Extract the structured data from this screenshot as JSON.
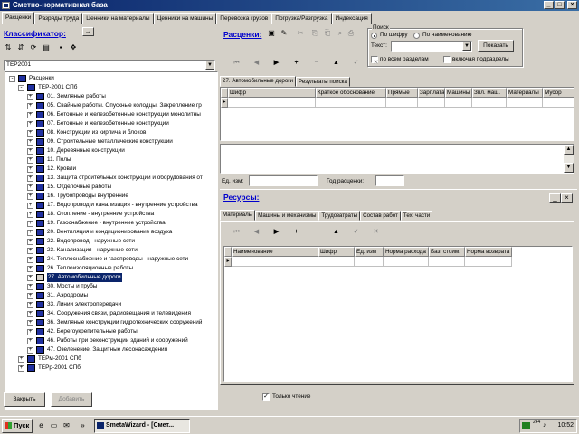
{
  "window": {
    "title": "Сметно-нормативная база"
  },
  "main_tabs": [
    "Расценки",
    "Разряды труда",
    "Ценники на материалы",
    "Ценники на машины",
    "Перевозка грузов",
    "Погрузка/Разгрузка",
    "Индексация"
  ],
  "classifier": {
    "title": "Классификатор:",
    "combo_value": "ТЕР2001",
    "tree": [
      {
        "label": "Расценки",
        "level": 0,
        "sign": "-"
      },
      {
        "label": "ТЕР-2001 СПб",
        "level": 1,
        "sign": "-"
      },
      {
        "label": "01. Земляные работы",
        "level": 2,
        "sign": "+"
      },
      {
        "label": "05. Свайные работы. Опускные колодцы. Закрепление гр",
        "level": 2,
        "sign": "+"
      },
      {
        "label": "06. Бетонные и железобетонные конструкции монолитны",
        "level": 2,
        "sign": "+"
      },
      {
        "label": "07. Бетонные и железобетонные конструкции",
        "level": 2,
        "sign": "+"
      },
      {
        "label": "08. Конструкции из кирпича и блоков",
        "level": 2,
        "sign": "+"
      },
      {
        "label": "09. Строительные металлические конструкции",
        "level": 2,
        "sign": "+"
      },
      {
        "label": "10. Деревянные конструкции",
        "level": 2,
        "sign": "+"
      },
      {
        "label": "11. Полы",
        "level": 2,
        "sign": "+"
      },
      {
        "label": "12. Кровли",
        "level": 2,
        "sign": "+"
      },
      {
        "label": "13. Защита строительных конструкций и оборудования от",
        "level": 2,
        "sign": "+"
      },
      {
        "label": "15. Отделочные работы",
        "level": 2,
        "sign": "+"
      },
      {
        "label": "16. Трубопроводы внутренние",
        "level": 2,
        "sign": "+"
      },
      {
        "label": "17. Водопровод и канализация - внутренние устройства",
        "level": 2,
        "sign": "+"
      },
      {
        "label": "18. Отопление - внутренние устройства",
        "level": 2,
        "sign": "+"
      },
      {
        "label": "19. Газоснабжение - внутренние устройства",
        "level": 2,
        "sign": "+"
      },
      {
        "label": "20. Вентиляция и кондиционирование воздуха",
        "level": 2,
        "sign": "+"
      },
      {
        "label": "22. Водопровод - наружные сети",
        "level": 2,
        "sign": "+"
      },
      {
        "label": "23. Канализация - наружные сети",
        "level": 2,
        "sign": "+"
      },
      {
        "label": "24. Теплоснабжение и газопроводы - наружные сети",
        "level": 2,
        "sign": "+"
      },
      {
        "label": "26. Теплоизоляционные работы",
        "level": 2,
        "sign": "+"
      },
      {
        "label": "27. Автомобильные дороги",
        "level": 2,
        "sign": "+",
        "selected": true
      },
      {
        "label": "30. Мосты и трубы",
        "level": 2,
        "sign": "+"
      },
      {
        "label": "31. Аэродромы",
        "level": 2,
        "sign": "+"
      },
      {
        "label": "33. Линии электропередачи",
        "level": 2,
        "sign": "+"
      },
      {
        "label": "34. Сооружения связи, радиовещания и телевидения",
        "level": 2,
        "sign": "+"
      },
      {
        "label": "36. Земляные конструкции гидротехнических сооружений",
        "level": 2,
        "sign": "+"
      },
      {
        "label": "42. Берегоукрепительные работы",
        "level": 2,
        "sign": "+"
      },
      {
        "label": "46. Работы при реконструкции зданий и сооружений",
        "level": 2,
        "sign": "+"
      },
      {
        "label": "47. Озеленение. Защитные лесонасаждения",
        "level": 2,
        "sign": "+"
      },
      {
        "label": "ТЕРм-2001 СПб",
        "level": 1,
        "sign": "+"
      },
      {
        "label": "ТЕРр-2001 СПб",
        "level": 1,
        "sign": "+"
      }
    ]
  },
  "rates": {
    "title": "Расценки:",
    "search": {
      "group_title": "Поиск",
      "by_code": "По шифру",
      "by_name": "По наименованию",
      "text_label": "Текст:",
      "show_button": "Показать",
      "all_sections": "по всем разделам",
      "include_subsections": "включая подразделы"
    },
    "tabs": [
      "27. Автомобильные дороги",
      "Результаты поиска"
    ],
    "columns": [
      "Шифр",
      "Краткое обоснование",
      "Прямые",
      "Зарплата",
      "Машины",
      "Зпл. маш.",
      "Материалы",
      "Мусор"
    ],
    "unit_label": "Ед. изм:",
    "year_label": "Год расценки:"
  },
  "resources": {
    "title": "Ресурсы:",
    "tabs": [
      "Материалы",
      "Машины и механизмы",
      "Трудозатраты",
      "Состав работ",
      "Тех. части"
    ],
    "columns": [
      "Наименование",
      "Шифр",
      "Ед. изм",
      "Норма расхода",
      "Баз. стоим.",
      "Норма возврата"
    ]
  },
  "bottom": {
    "close_button": "Закрыть",
    "add_button": "Добавить",
    "readonly_label": "Только чтение"
  },
  "taskbar": {
    "start": "Пуск",
    "task": "SmetaWizard - [Смет...",
    "clock": "10:52",
    "tray_text": "244"
  },
  "colors": {
    "title_start": "#0a246a",
    "title_end": "#3a6ea5",
    "section_title": "#0000cc",
    "selection": "#0a246a"
  }
}
